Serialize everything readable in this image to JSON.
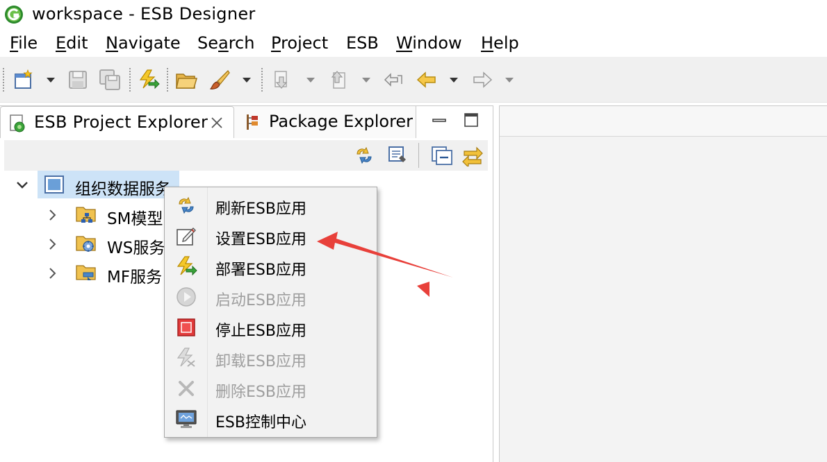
{
  "window": {
    "title": "workspace - ESB Designer"
  },
  "menu": [
    {
      "pre": "",
      "mn": "F",
      "post": "ile"
    },
    {
      "pre": "",
      "mn": "E",
      "post": "dit"
    },
    {
      "pre": "",
      "mn": "N",
      "post": "avigate"
    },
    {
      "pre": "Se",
      "mn": "a",
      "post": "rch"
    },
    {
      "pre": "",
      "mn": "P",
      "post": "roject"
    },
    {
      "pre": "ESB",
      "mn": "",
      "post": ""
    },
    {
      "pre": "",
      "mn": "W",
      "post": "indow"
    },
    {
      "pre": "",
      "mn": "H",
      "post": "elp"
    }
  ],
  "tabs": {
    "active": {
      "label": "ESB Project Explorer",
      "close_glyph": "⊠"
    },
    "inactive": {
      "label": "Package Explorer"
    }
  },
  "tree": {
    "root": {
      "label": "组织数据服务"
    },
    "children": [
      {
        "label": "SM模型"
      },
      {
        "label": "WS服务"
      },
      {
        "label": "MF服务"
      }
    ]
  },
  "context_menu": {
    "items": [
      {
        "label": "刷新ESB应用",
        "icon": "refresh-icon",
        "enabled": true
      },
      {
        "label": "设置ESB应用",
        "icon": "settings-edit-icon",
        "enabled": true
      },
      {
        "label": "部署ESB应用",
        "icon": "deploy-icon",
        "enabled": true
      },
      {
        "label": "启动ESB应用",
        "icon": "play-icon",
        "enabled": false
      },
      {
        "label": "停止ESB应用",
        "icon": "stop-icon",
        "enabled": true
      },
      {
        "label": "卸载ESB应用",
        "icon": "undeploy-icon",
        "enabled": false
      },
      {
        "label": "删除ESB应用",
        "icon": "delete-icon",
        "enabled": false
      },
      {
        "label": "ESB控制中心",
        "icon": "monitor-icon",
        "enabled": true
      }
    ]
  },
  "colors": {
    "annotation_arrow": "#e8403a",
    "selection": "#cde3f7",
    "disabled_text": "#9e9e9e"
  }
}
